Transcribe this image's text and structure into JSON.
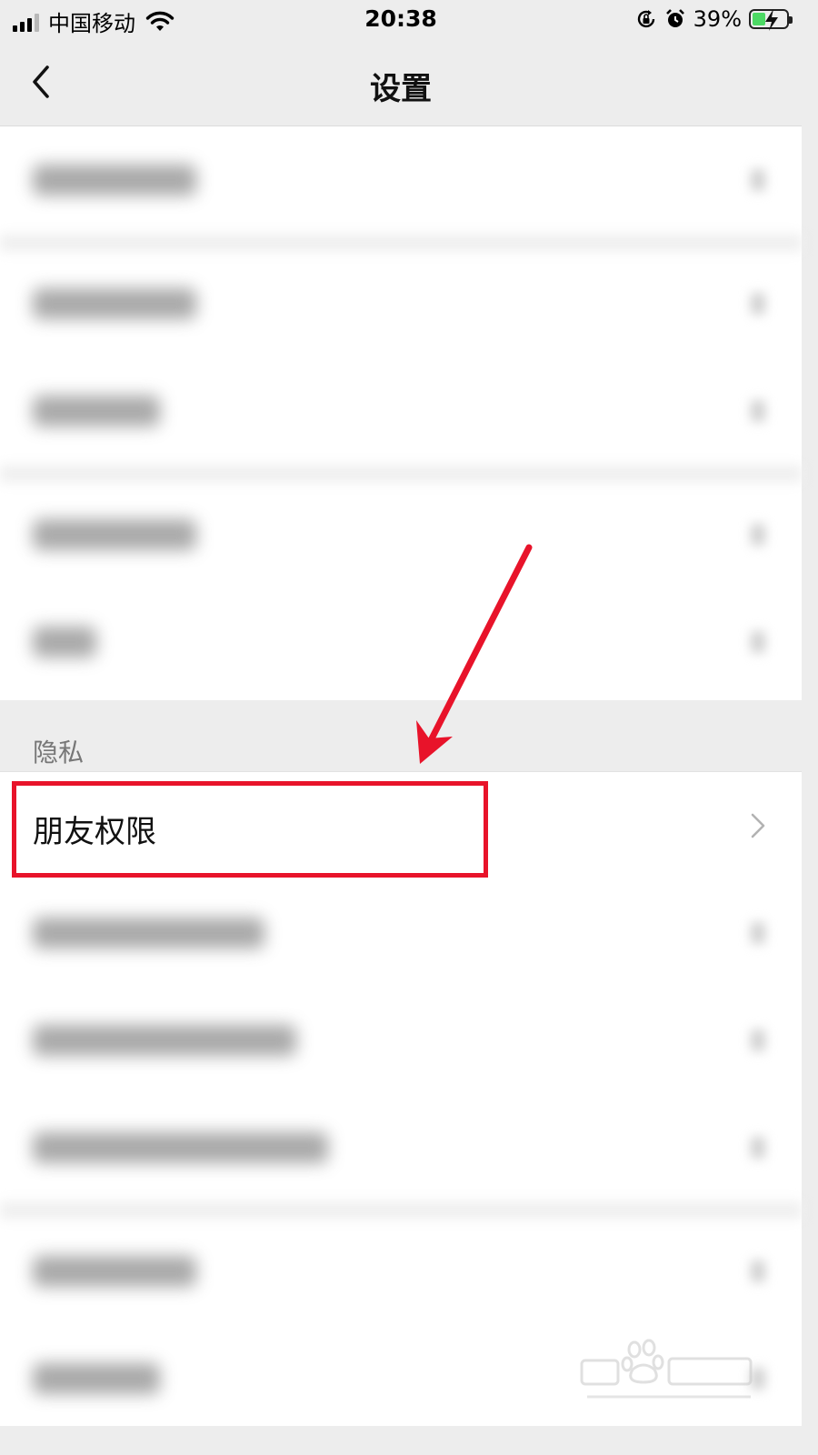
{
  "status_bar": {
    "carrier": "中国移动",
    "time": "20:38",
    "battery_percent": "39%",
    "battery_level": 0.39,
    "icons": [
      "signal-icon",
      "wifi-icon",
      "orientation-lock-icon",
      "alarm-icon",
      "battery-charging-icon"
    ]
  },
  "nav": {
    "title": "设置",
    "back_icon": "chevron-left-icon"
  },
  "privacy_section": {
    "header": "隐私",
    "highlighted_item": {
      "label": "朋友权限",
      "icon": "chevron-right-icon"
    }
  },
  "annotation": {
    "color": "#e8132a"
  },
  "colors": {
    "background": "#ededed",
    "cell": "#ffffff",
    "annotation_red": "#e8132a"
  }
}
